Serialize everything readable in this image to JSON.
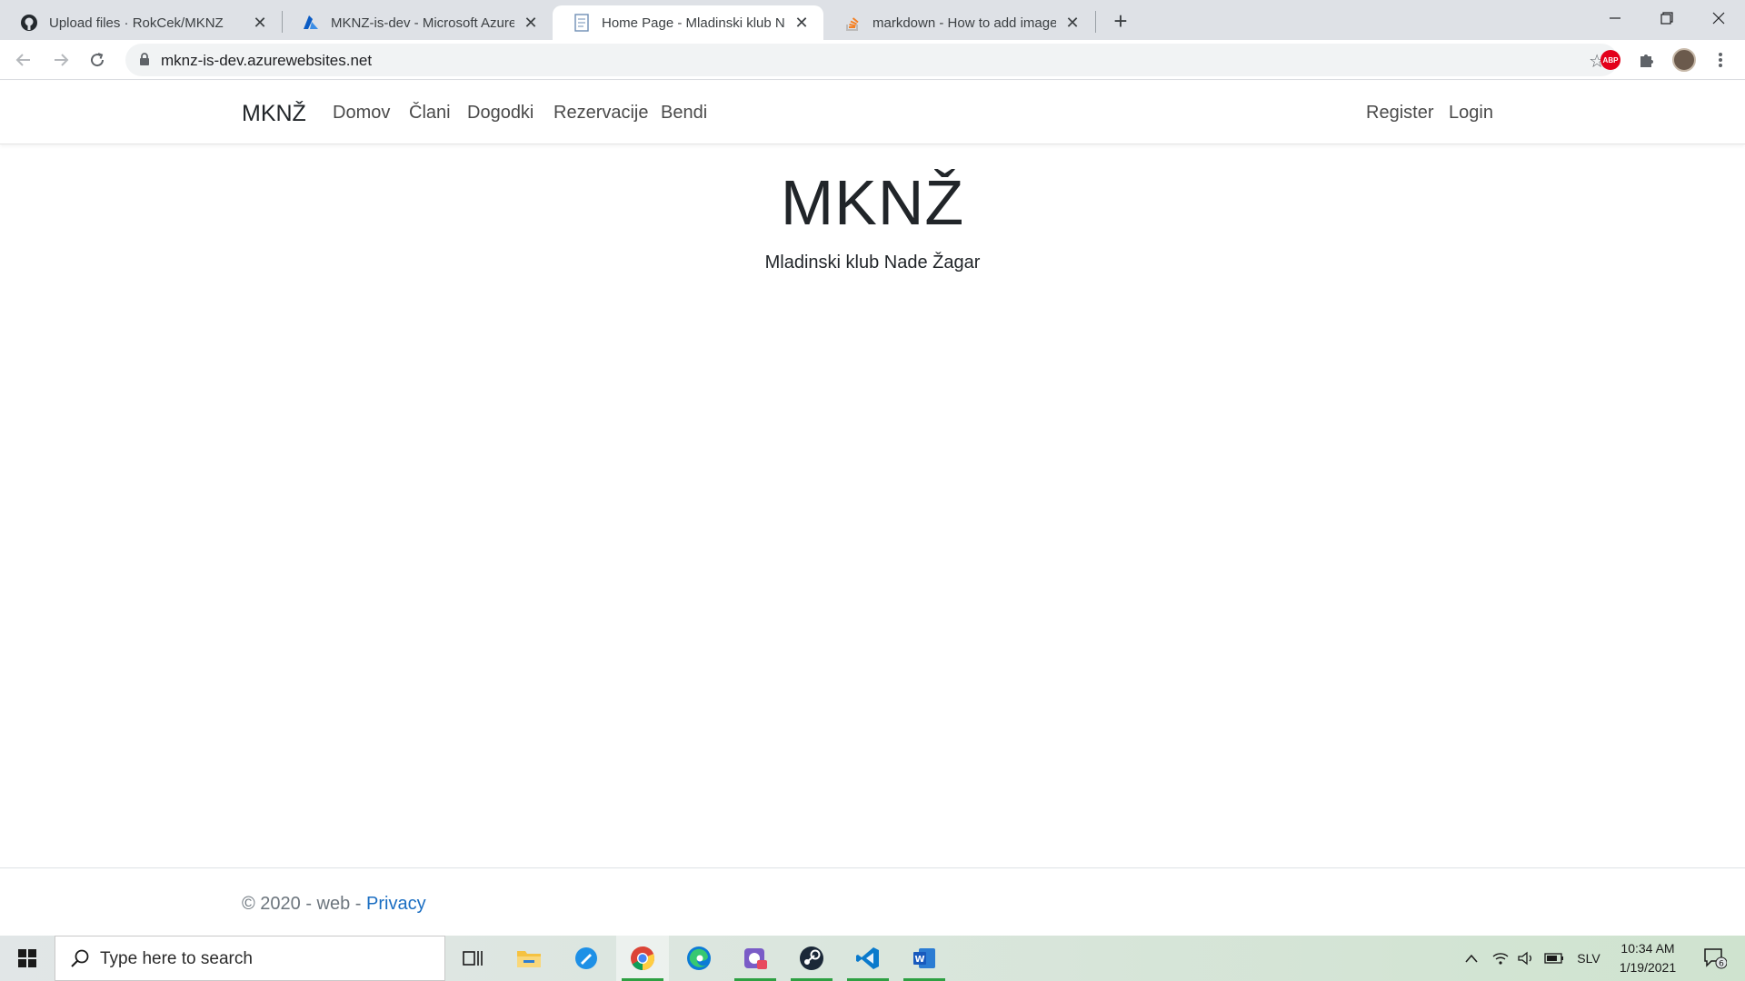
{
  "browser": {
    "tabs": [
      {
        "title": "Upload files · RokCek/MKNZ",
        "icon": "github-icon",
        "active": false
      },
      {
        "title": "MKNZ-is-dev - Microsoft Azure",
        "icon": "azure-icon",
        "active": false
      },
      {
        "title": "Home Page - Mladinski klub Nad",
        "icon": "document-icon",
        "active": true
      },
      {
        "title": "markdown - How to add images",
        "icon": "stackoverflow-icon",
        "active": false
      }
    ],
    "url": "mknz-is-dev.azurewebsites.net"
  },
  "site": {
    "brand": "MKNŽ",
    "nav": [
      "Domov",
      "Člani",
      "Dogodki",
      "Rezervacije",
      "Bendi"
    ],
    "auth": [
      "Register",
      "Login"
    ],
    "hero": {
      "title": "MKNŽ",
      "subtitle": "Mladinski klub Nade Žagar"
    },
    "footer": {
      "text": "© 2020 - web - ",
      "link": "Privacy"
    }
  },
  "taskbar": {
    "search_placeholder": "Type here to search",
    "language": "SLV",
    "time": "10:34 AM",
    "date": "1/19/2021",
    "notifications": "6",
    "apps": [
      "task-view-icon",
      "file-explorer-icon",
      "feedback-icon",
      "chrome-icon",
      "edge-icon",
      "game-icon",
      "steam-icon",
      "vscode-icon",
      "word-icon"
    ]
  }
}
